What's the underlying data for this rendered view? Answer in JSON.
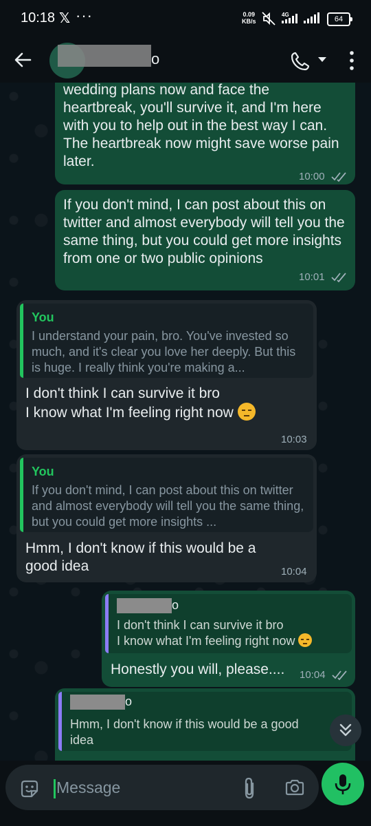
{
  "status_bar": {
    "time": "10:18",
    "rate_value": "0.09",
    "rate_unit": "KB/s",
    "network": "4G",
    "battery": "64"
  },
  "header": {
    "contact_name_visible_tail": "o"
  },
  "messages": [
    {
      "direction": "outgoing",
      "text": "paching ahead, you can really cancel all the wedding plans now and face the heartbreak, you'll survive it, and I'm here with you to help out in the best way I can. The heartbreak now might save worse pain later.",
      "time": "10:00",
      "status": "read"
    },
    {
      "direction": "outgoing",
      "text": "If you don't mind, I can post about this on twitter and almost everybody will tell you the same thing, but you could get more insights from one or two public opinions",
      "time": "10:01",
      "status": "read"
    },
    {
      "direction": "incoming",
      "quote_sender": "You",
      "quote_text": "I understand your pain, bro. You've invested so much, and it's clear you love her deeply. But this is huge. I really think you're making a...",
      "text": "I don't think I can survive it bro\nI know what I'm feeling right now",
      "emoji": "pensive-face",
      "time": "10:03"
    },
    {
      "direction": "incoming",
      "quote_sender": "You",
      "quote_text": "If you don't mind, I can post about this on twitter and almost everybody will tell you the same thing, but you could get more insights ...",
      "text": "Hmm, I don't know if this would be a good idea",
      "time": "10:04"
    },
    {
      "direction": "outgoing",
      "quote_sender_visible_tail": "o",
      "quote_text": "I don't think I can survive it bro\nI know what I'm feeling right now",
      "quote_emoji": "pensive-face",
      "text": "Honestly you will, please....",
      "time": "10:04",
      "status": "read"
    },
    {
      "direction": "outgoing",
      "quote_sender_visible_tail": "o",
      "quote_text": "Hmm, I don't know if this would be a good idea"
    }
  ],
  "composer": {
    "placeholder": "Message"
  },
  "colors": {
    "outgoing_bubble": "#134d37",
    "incoming_bubble": "#1f272c",
    "accent": "#21c063",
    "quote_bar_incoming": "#22c55e",
    "quote_bar_outgoing": "#8b7cf6"
  }
}
